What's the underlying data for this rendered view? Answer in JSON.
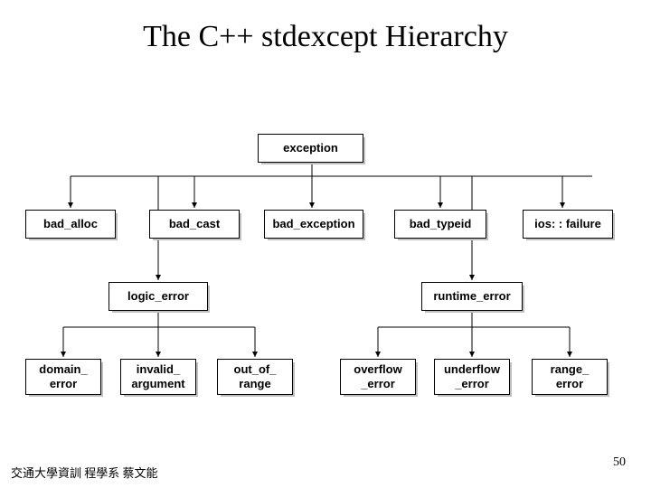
{
  "title": "The C++ stdexcept Hierarchy",
  "footer": "交通大學資訓 程學系 蔡文能",
  "page_number": "50",
  "hierarchy": {
    "root": "exception",
    "level2": [
      "bad_alloc",
      "bad_cast",
      "bad_exception",
      "bad_typeid",
      "ios: : failure"
    ],
    "level3": [
      "logic_error",
      "runtime_error"
    ],
    "logic_error_children": [
      "domain_\nerror",
      "invalid_\nargument",
      "out_of_\nrange"
    ],
    "runtime_error_children": [
      "overflow\n_error",
      "underflow\n_error",
      "range_\nerror"
    ]
  }
}
